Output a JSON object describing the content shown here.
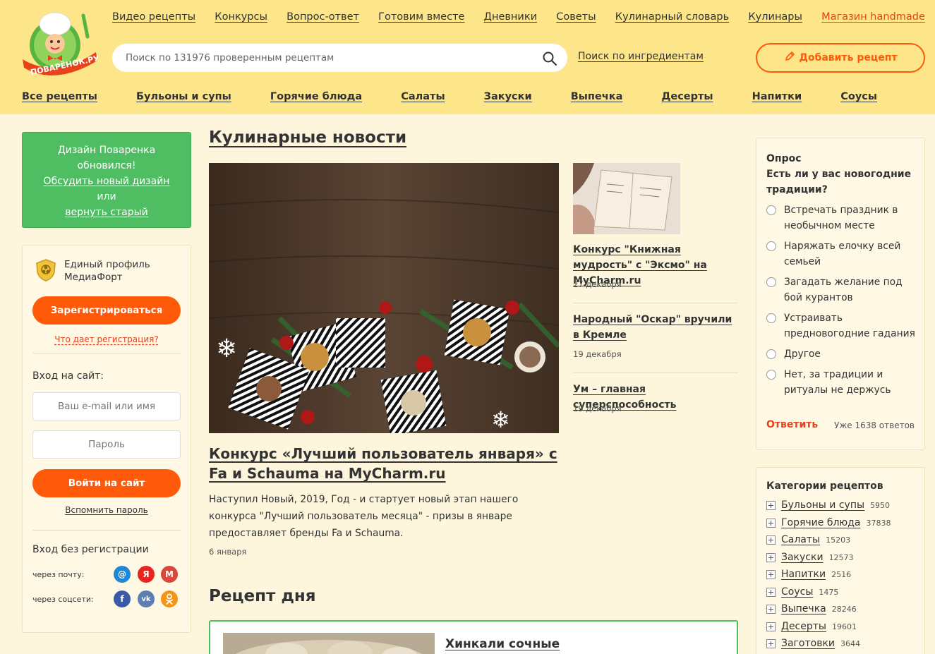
{
  "logo": {
    "text": "ПОВАРЁНОК.РУ"
  },
  "topnav": [
    "Видео рецепты",
    "Конкурсы",
    "Вопрос-ответ",
    "Готовим вместе",
    "Дневники",
    "Советы",
    "Кулинарный словарь",
    "Кулинары",
    "Магазин handmade"
  ],
  "search": {
    "placeholder": "Поиск по 131976 проверенным рецептам",
    "icon": "search-icon",
    "ingredients_link": "Поиск по ингредиентам"
  },
  "add_recipe": {
    "label": "Добавить рецепт",
    "icon": "pencil-icon"
  },
  "catnav": [
    "Все рецепты",
    "Бульоны и супы",
    "Горячие блюда",
    "Салаты",
    "Закуски",
    "Выпечка",
    "Десерты",
    "Напитки",
    "Соусы"
  ],
  "design_notice": {
    "line1": "Дизайн Поваренка",
    "line2": "обновился!",
    "discuss_link": "Обсудить новый дизайн",
    "or": "или",
    "revert_link": "вернуть старый"
  },
  "profile": {
    "title": "Единый профиль МедиаФорт",
    "register_button": "Зарегистрироваться",
    "what_register": "Что дает регистрация?",
    "login_label": "Вход на сайт:",
    "email_placeholder": "Ваш e-mail или имя",
    "password_placeholder": "Пароль",
    "login_button": "Войти на сайт",
    "remember_link": "Вспомнить пароль",
    "no_register_label": "Вход без регистрации",
    "via_mail": "через почту:",
    "via_social": "через соцсети:",
    "mail_icons": [
      "at-icon",
      "yandex-icon",
      "gmail-icon"
    ],
    "social_icons": [
      "facebook-icon",
      "vk-icon",
      "odnoklassniki-icon"
    ],
    "yandex_letter": "Я",
    "vk_text": "vk",
    "gmail_letter": "M",
    "facebook_letter": "f"
  },
  "news": {
    "heading": "Кулинарные новости",
    "main": {
      "title": "Конкурс «Лучший пользователь января» с Fa и Schauma на MyCharm.ru",
      "text": "Наступил Новый, 2019, Год - и стартует новый этап нашего конкурса \"Лучший пользователь месяца\" - призы в январе предоставляет бренды Fa и Schauma.",
      "date": "6 января"
    },
    "items": [
      {
        "title": "Конкурс \"Книжная мудрость\" с \"Эксмо\" на MyCharm.ru",
        "date": "27 декабря"
      },
      {
        "title": "Народный \"Оскар\" вручили в Кремле",
        "date": "19 декабря"
      },
      {
        "title": "Ум – главная суперспособность",
        "date": "19 декабря"
      }
    ]
  },
  "recipe_of_day": {
    "heading": "Рецепт дня",
    "title": "Хинкали сочные"
  },
  "poll": {
    "label": "Опрос",
    "question": "Есть ли у вас новогодние традиции?",
    "options": [
      "Встречать праздник в необычном месте",
      "Наряжать елочку всей семьей",
      "Загадать желание под бой курантов",
      "Устраивать предновогодние гадания",
      "Другое",
      "Нет, за традиции и ритуалы не держусь"
    ],
    "answer_button": "Ответить",
    "count": "Уже 1638 ответов"
  },
  "categories": {
    "title": "Категории рецептов",
    "items": [
      {
        "name": "Бульоны и супы",
        "count": "5950"
      },
      {
        "name": "Горячие блюда",
        "count": "37838"
      },
      {
        "name": "Салаты",
        "count": "15203"
      },
      {
        "name": "Закуски",
        "count": "12573"
      },
      {
        "name": "Напитки",
        "count": "2516"
      },
      {
        "name": "Соусы",
        "count": "1475"
      },
      {
        "name": "Выпечка",
        "count": "28246"
      },
      {
        "name": "Десерты",
        "count": "19601"
      },
      {
        "name": "Заготовки",
        "count": "3644"
      }
    ]
  },
  "colors": {
    "header": "#fde58a",
    "accent": "#ff5a0a",
    "green": "#4fbe63",
    "background": "#fdf5dc"
  }
}
